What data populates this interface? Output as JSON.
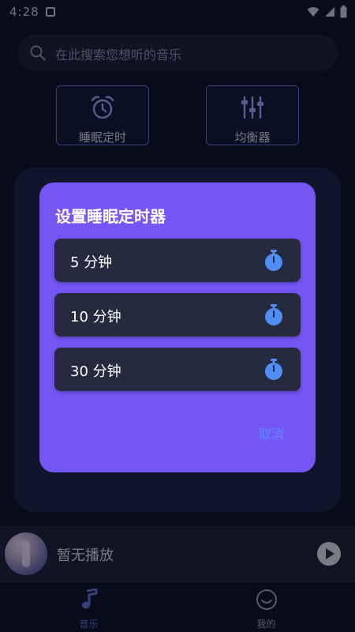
{
  "status": {
    "time": "4:28"
  },
  "search": {
    "placeholder": "在此搜索您想听的音乐"
  },
  "features": [
    {
      "label": "睡眠定时",
      "icon": "alarm-clock-icon"
    },
    {
      "label": "均衡器",
      "icon": "equalizer-icon"
    }
  ],
  "player": {
    "title": "暂无播放"
  },
  "tabs": [
    {
      "label": "音乐",
      "icon": "music-note-icon",
      "active": true,
      "color": "#5a6fd6"
    },
    {
      "label": "我的",
      "icon": "profile-icon",
      "active": false,
      "color": "#9aa0b8"
    }
  ],
  "dialog": {
    "title": "设置睡眠定时器",
    "options": [
      {
        "label": "5 分钟",
        "icon": "stopwatch-icon"
      },
      {
        "label": "10 分钟",
        "icon": "stopwatch-icon"
      },
      {
        "label": "30 分钟",
        "icon": "stopwatch-icon"
      }
    ],
    "cancel_label": "取消"
  },
  "colors": {
    "dialog_bg": "#7655f5",
    "option_bg": "#262a3e",
    "accent": "#5d8bff",
    "stopwatch": "#4f8ef7"
  }
}
